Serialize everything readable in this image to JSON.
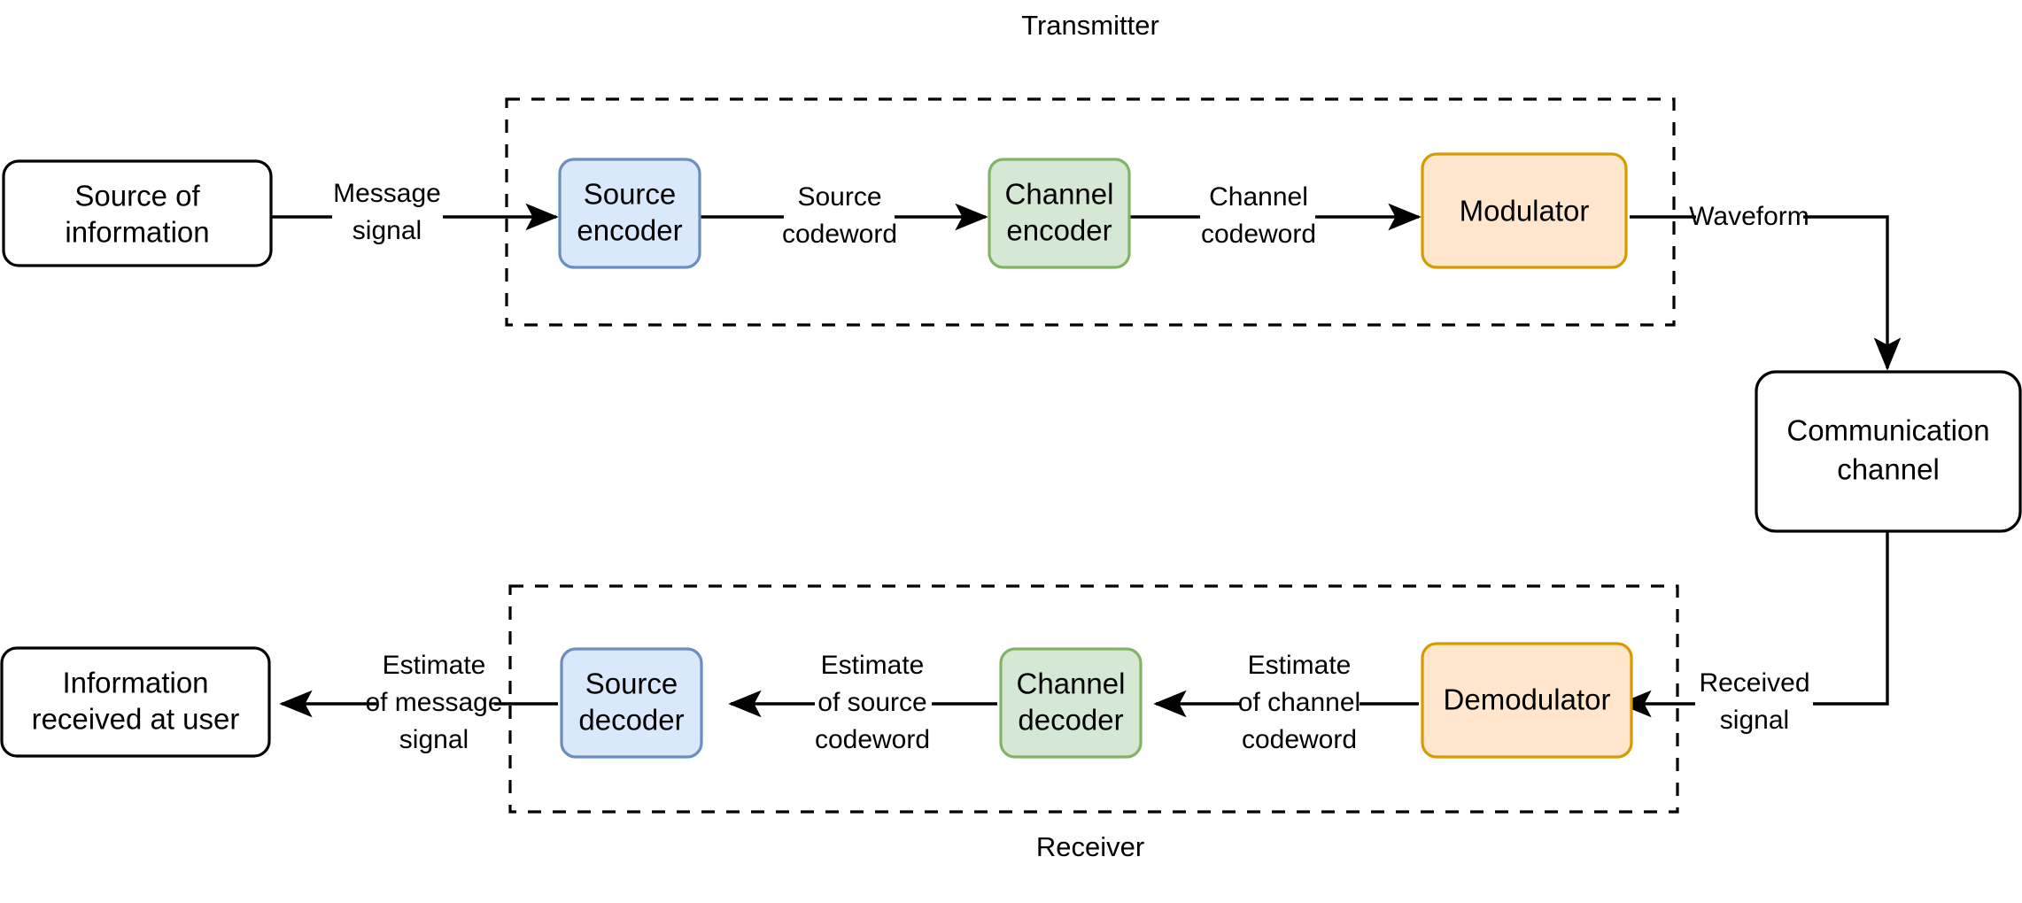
{
  "diagram": {
    "title_transmitter": "Transmitter",
    "title_receiver": "Receiver",
    "colors": {
      "blue_fill": "#dae8fc",
      "blue_stroke": "#6c8ebf",
      "green_fill": "#d5e8d4",
      "green_stroke": "#82b366",
      "orange_fill": "#ffe6cc",
      "orange_stroke": "#d79b00",
      "plain_fill": "#ffffff",
      "plain_stroke": "#000000",
      "line": "#000000",
      "background": "#ffffff"
    },
    "nodes": {
      "source_of_information": {
        "line1": "Source of",
        "line2": "information"
      },
      "source_encoder": {
        "line1": "Source",
        "line2": "encoder"
      },
      "channel_encoder": {
        "line1": "Channel",
        "line2": "encoder"
      },
      "modulator": {
        "line1": "Modulator",
        "line2": ""
      },
      "communication_channel": {
        "line1": "Communication",
        "line2": "channel"
      },
      "demodulator": {
        "line1": "Demodulator",
        "line2": ""
      },
      "channel_decoder": {
        "line1": "Channel",
        "line2": "decoder"
      },
      "source_decoder": {
        "line1": "Source",
        "line2": "decoder"
      },
      "information_received": {
        "line1": "Information",
        "line2": "received at user"
      }
    },
    "edge_labels": {
      "message_signal": {
        "line1": "Message",
        "line2": "signal",
        "line3": ""
      },
      "source_codeword": {
        "line1": "Source",
        "line2": "codeword",
        "line3": ""
      },
      "channel_codeword": {
        "line1": "Channel",
        "line2": "codeword",
        "line3": ""
      },
      "waveform": {
        "line1": "Waveform",
        "line2": "",
        "line3": ""
      },
      "received_signal": {
        "line1": "Received",
        "line2": "signal",
        "line3": ""
      },
      "estimate_of_channel_codeword": {
        "line1": "Estimate",
        "line2": "of channel",
        "line3": "codeword"
      },
      "estimate_of_source_codeword": {
        "line1": "Estimate",
        "line2": "of source",
        "line3": "codeword"
      },
      "estimate_of_message_signal": {
        "line1": "Estimate",
        "line2": "of message",
        "line3": "signal"
      }
    }
  }
}
